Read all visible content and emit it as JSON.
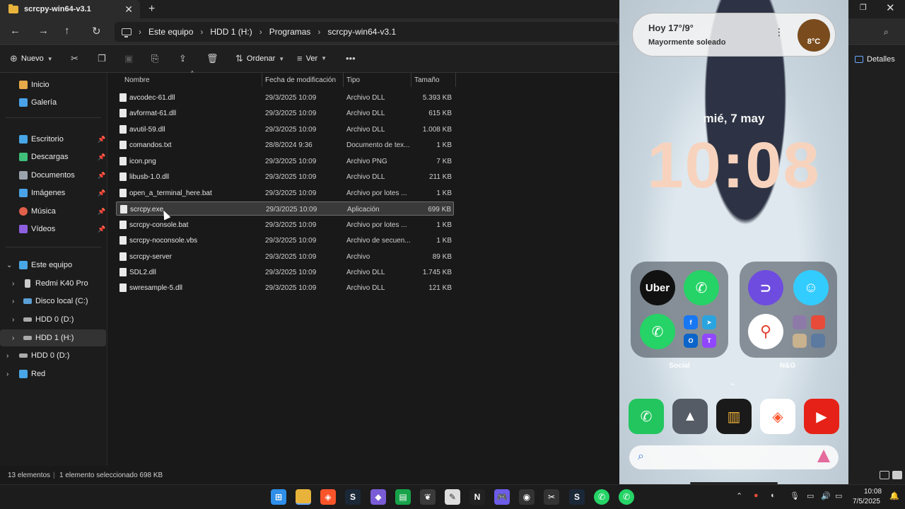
{
  "window": {
    "tab_title": "scrcpy-win64-v3.1"
  },
  "address": {
    "crumbs": [
      "Este equipo",
      "HDD 1 (H:)",
      "Programas",
      "scrcpy-win64-v3.1"
    ]
  },
  "toolbar": {
    "new_label": "Nuevo",
    "sort_label": "Ordenar",
    "view_label": "Ver",
    "more_label": "•••",
    "details_label": "Detalles"
  },
  "sidebar": {
    "items": [
      {
        "label": "Inicio",
        "icon": "home-icon",
        "color": "#e8a94a"
      },
      {
        "label": "Galería",
        "icon": "gallery-icon",
        "color": "#4aa3e8"
      },
      {
        "label": "Escritorio",
        "icon": "desktop-icon",
        "color": "#49a6e6"
      },
      {
        "label": "Descargas",
        "icon": "download-icon",
        "color": "#3fbf7a"
      },
      {
        "label": "Documentos",
        "icon": "documents-icon",
        "color": "#9aa3ad"
      },
      {
        "label": "Imágenes",
        "icon": "pictures-icon",
        "color": "#4aa3e8"
      },
      {
        "label": "Música",
        "icon": "music-icon",
        "color": "#e0604a"
      },
      {
        "label": "Vídeos",
        "icon": "videos-icon",
        "color": "#8d5ee0"
      }
    ],
    "tree": [
      {
        "label": "Este equipo",
        "icon": "pc-icon"
      },
      {
        "label": "Redmi K40 Pro",
        "icon": "phone-icon"
      },
      {
        "label": "Disco local (C:)",
        "icon": "drive-icon"
      },
      {
        "label": "HDD 0 (D:)",
        "icon": "drive-icon"
      },
      {
        "label": "HDD 1 (H:)",
        "icon": "drive-icon"
      },
      {
        "label": "HDD 0 (D:)",
        "icon": "drive-icon"
      },
      {
        "label": "Red",
        "icon": "network-icon"
      }
    ]
  },
  "columns": {
    "name": "Nombre",
    "date": "Fecha de modificación",
    "type": "Tipo",
    "size": "Tamaño"
  },
  "files": [
    {
      "name": "avcodec-61.dll",
      "date": "29/3/2025 10:09",
      "type": "Archivo DLL",
      "size": "5.393 KB"
    },
    {
      "name": "avformat-61.dll",
      "date": "29/3/2025 10:09",
      "type": "Archivo DLL",
      "size": "615 KB"
    },
    {
      "name": "avutil-59.dll",
      "date": "29/3/2025 10:09",
      "type": "Archivo DLL",
      "size": "1.008 KB"
    },
    {
      "name": "comandos.txt",
      "date": "28/8/2024 9:36",
      "type": "Documento de tex...",
      "size": "1 KB"
    },
    {
      "name": "icon.png",
      "date": "29/3/2025 10:09",
      "type": "Archivo PNG",
      "size": "7 KB"
    },
    {
      "name": "libusb-1.0.dll",
      "date": "29/3/2025 10:09",
      "type": "Archivo DLL",
      "size": "211 KB"
    },
    {
      "name": "open_a_terminal_here.bat",
      "date": "29/3/2025 10:09",
      "type": "Archivo por lotes ...",
      "size": "1 KB"
    },
    {
      "name": "scrcpy.exe",
      "date": "29/3/2025 10:09",
      "type": "Aplicación",
      "size": "699 KB",
      "selected": true
    },
    {
      "name": "scrcpy-console.bat",
      "date": "29/3/2025 10:09",
      "type": "Archivo por lotes ...",
      "size": "1 KB"
    },
    {
      "name": "scrcpy-noconsole.vbs",
      "date": "29/3/2025 10:09",
      "type": "Archivo de secuen...",
      "size": "1 KB"
    },
    {
      "name": "scrcpy-server",
      "date": "29/3/2025 10:09",
      "type": "Archivo",
      "size": "89 KB"
    },
    {
      "name": "SDL2.dll",
      "date": "29/3/2025 10:09",
      "type": "Archivo DLL",
      "size": "1.745 KB"
    },
    {
      "name": "swresample-5.dll",
      "date": "29/3/2025 10:09",
      "type": "Archivo DLL",
      "size": "121 KB"
    }
  ],
  "status": {
    "count": "13 elementos",
    "selection": "1 elemento seleccionado  698 KB"
  },
  "phone": {
    "weather_title": "Hoy 17°/9°",
    "weather_sub": "Mayormente soleado",
    "weather_temp": "8°C",
    "date": "mié, 7 may",
    "time": "10:08",
    "folder_left": "Social",
    "folder_right": "N&G",
    "uber_label": "Uber"
  },
  "clock": {
    "time": "10:08",
    "date": "7/5/2025"
  }
}
